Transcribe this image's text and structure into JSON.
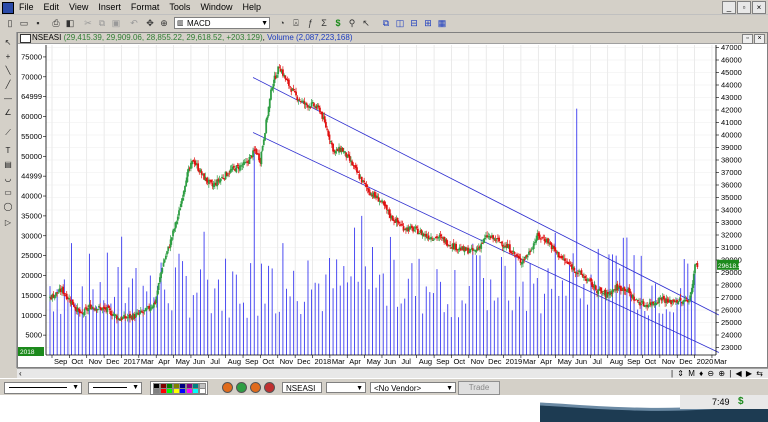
{
  "menu": [
    "File",
    "Edit",
    "View",
    "Insert",
    "Format",
    "Tools",
    "Window",
    "Help"
  ],
  "toolbar": {
    "indicator": "MACD"
  },
  "chart_window": {
    "title_symbol": "NSEASI",
    "title_quote": "(29,415.39, 29,909.06, 28,855.22, 29,618.52, +203.129)",
    "title_volume": "Volume (2,087,223,168)"
  },
  "bottombar": {
    "symbol": "NSEASI",
    "vendor": "<No Vendor>",
    "trade": "Trade"
  },
  "status": {
    "time": "7:49",
    "dollar": "$"
  },
  "colors": {
    "up": "#2f9e44",
    "down": "#e01010",
    "volume": "#3a3af0",
    "channel": "#2f2fd0",
    "price_badge": "#1c8a1c"
  },
  "chart_data": {
    "type": "candlestick",
    "title": "NSEASI",
    "price_axis_ticks": [
      23000,
      24000,
      25000,
      26000,
      27000,
      28000,
      29000,
      30000,
      31000,
      32000,
      33000,
      34000,
      35000,
      36000,
      37000,
      38000,
      39000,
      40000,
      41000,
      42000,
      43000,
      44000,
      45000,
      46000,
      47000
    ],
    "price_range": [
      22400,
      47200
    ],
    "price_tag": "29618.52",
    "volume_axis_ticks": [
      "5000",
      "10000",
      "15000",
      "20000",
      "25000",
      "30000",
      "35000",
      "40000",
      "44999",
      "50000",
      "55000",
      "60000",
      "64999",
      "70000",
      "75000"
    ],
    "volume_range": [
      0,
      78000
    ],
    "volume_label": "2018",
    "x_labels": [
      "Sep",
      "Oct",
      "Nov",
      "Dec",
      "2017",
      "Mar",
      "Apr",
      "May",
      "Jun",
      "Jul",
      "Aug",
      "Sep",
      "Oct",
      "Nov",
      "Dec",
      "2018",
      "Mar",
      "Apr",
      "May",
      "Jun",
      "Jul",
      "Aug",
      "Sep",
      "Oct",
      "Nov",
      "Dec",
      "2019",
      "Mar",
      "Apr",
      "May",
      "Jun",
      "Jul",
      "Aug",
      "Sep",
      "Oct",
      "Nov",
      "Dec",
      "2020",
      "Mar"
    ],
    "price_path": [
      [
        0,
        27000
      ],
      [
        10,
        27600
      ],
      [
        20,
        26400
      ],
      [
        26,
        25600
      ],
      [
        34,
        26300
      ],
      [
        48,
        26000
      ],
      [
        58,
        25300
      ],
      [
        70,
        25500
      ],
      [
        80,
        25900
      ],
      [
        88,
        26600
      ],
      [
        94,
        29500
      ],
      [
        100,
        31200
      ],
      [
        108,
        33800
      ],
      [
        114,
        36600
      ],
      [
        120,
        38000
      ],
      [
        128,
        36700
      ],
      [
        136,
        35900
      ],
      [
        144,
        36600
      ],
      [
        152,
        37200
      ],
      [
        164,
        37700
      ],
      [
        172,
        38800
      ],
      [
        176,
        38000
      ],
      [
        180,
        40400
      ],
      [
        186,
        44000
      ],
      [
        192,
        45500
      ],
      [
        198,
        44300
      ],
      [
        206,
        43100
      ],
      [
        214,
        42400
      ],
      [
        220,
        42400
      ],
      [
        226,
        42000
      ],
      [
        232,
        40400
      ],
      [
        238,
        38600
      ],
      [
        244,
        38900
      ],
      [
        252,
        37800
      ],
      [
        260,
        36500
      ],
      [
        268,
        35400
      ],
      [
        276,
        34800
      ],
      [
        286,
        33400
      ],
      [
        296,
        32600
      ],
      [
        306,
        32400
      ],
      [
        316,
        31900
      ],
      [
        326,
        31800
      ],
      [
        336,
        31200
      ],
      [
        346,
        30800
      ],
      [
        356,
        30700
      ],
      [
        366,
        31900
      ],
      [
        376,
        31500
      ],
      [
        386,
        30800
      ],
      [
        394,
        29900
      ],
      [
        400,
        30400
      ],
      [
        408,
        31900
      ],
      [
        416,
        31600
      ],
      [
        422,
        30800
      ],
      [
        430,
        30000
      ],
      [
        440,
        29200
      ],
      [
        450,
        28400
      ],
      [
        458,
        27600
      ],
      [
        466,
        27200
      ],
      [
        474,
        27800
      ],
      [
        482,
        27700
      ],
      [
        490,
        26800
      ],
      [
        498,
        26400
      ],
      [
        506,
        26600
      ],
      [
        512,
        27000
      ],
      [
        518,
        26600
      ],
      [
        524,
        26800
      ],
      [
        530,
        26600
      ],
      [
        536,
        27000
      ],
      [
        540,
        29500
      ],
      [
        542,
        29600
      ]
    ],
    "volume_spikes": [
      [
        170,
        52000
      ],
      [
        260,
        35000
      ],
      [
        355,
        28000
      ],
      [
        440,
        62000
      ],
      [
        474,
        25000
      ],
      [
        533,
        23000
      ]
    ],
    "channel_lines": [
      {
        "from": [
          170,
          44600
        ],
        "to": [
          560,
          25600
        ]
      },
      {
        "from": [
          170,
          40200
        ],
        "to": [
          560,
          22600
        ]
      }
    ]
  }
}
